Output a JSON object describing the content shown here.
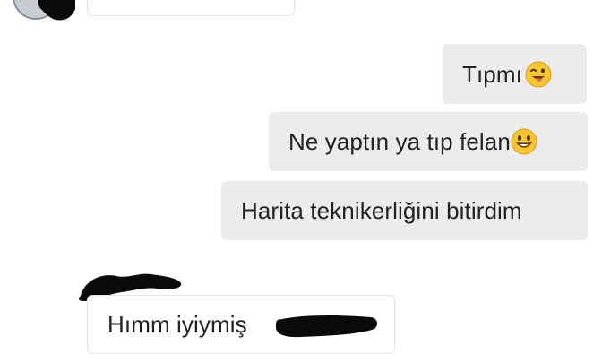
{
  "conversation": {
    "messages": [
      {
        "direction": "incoming",
        "text": ""
      },
      {
        "direction": "outgoing",
        "text": "Tıpmı",
        "emoji": "winking-face-with-tongue-icon"
      },
      {
        "direction": "outgoing",
        "text": "Ne yaptın ya tıp felan",
        "emoji": "grinning-face-icon"
      },
      {
        "direction": "outgoing",
        "text": "Harita teknikerliğini bitirdim"
      },
      {
        "direction": "incoming",
        "text": "Hımm iyiymiş"
      }
    ]
  },
  "colors": {
    "background": "#ffffff",
    "outgoing_bubble": "#ececec",
    "incoming_bubble_border": "#e3e3e3",
    "text": "#222222",
    "emoji_face": "#f7c533",
    "redaction": "#0a0a0a"
  }
}
